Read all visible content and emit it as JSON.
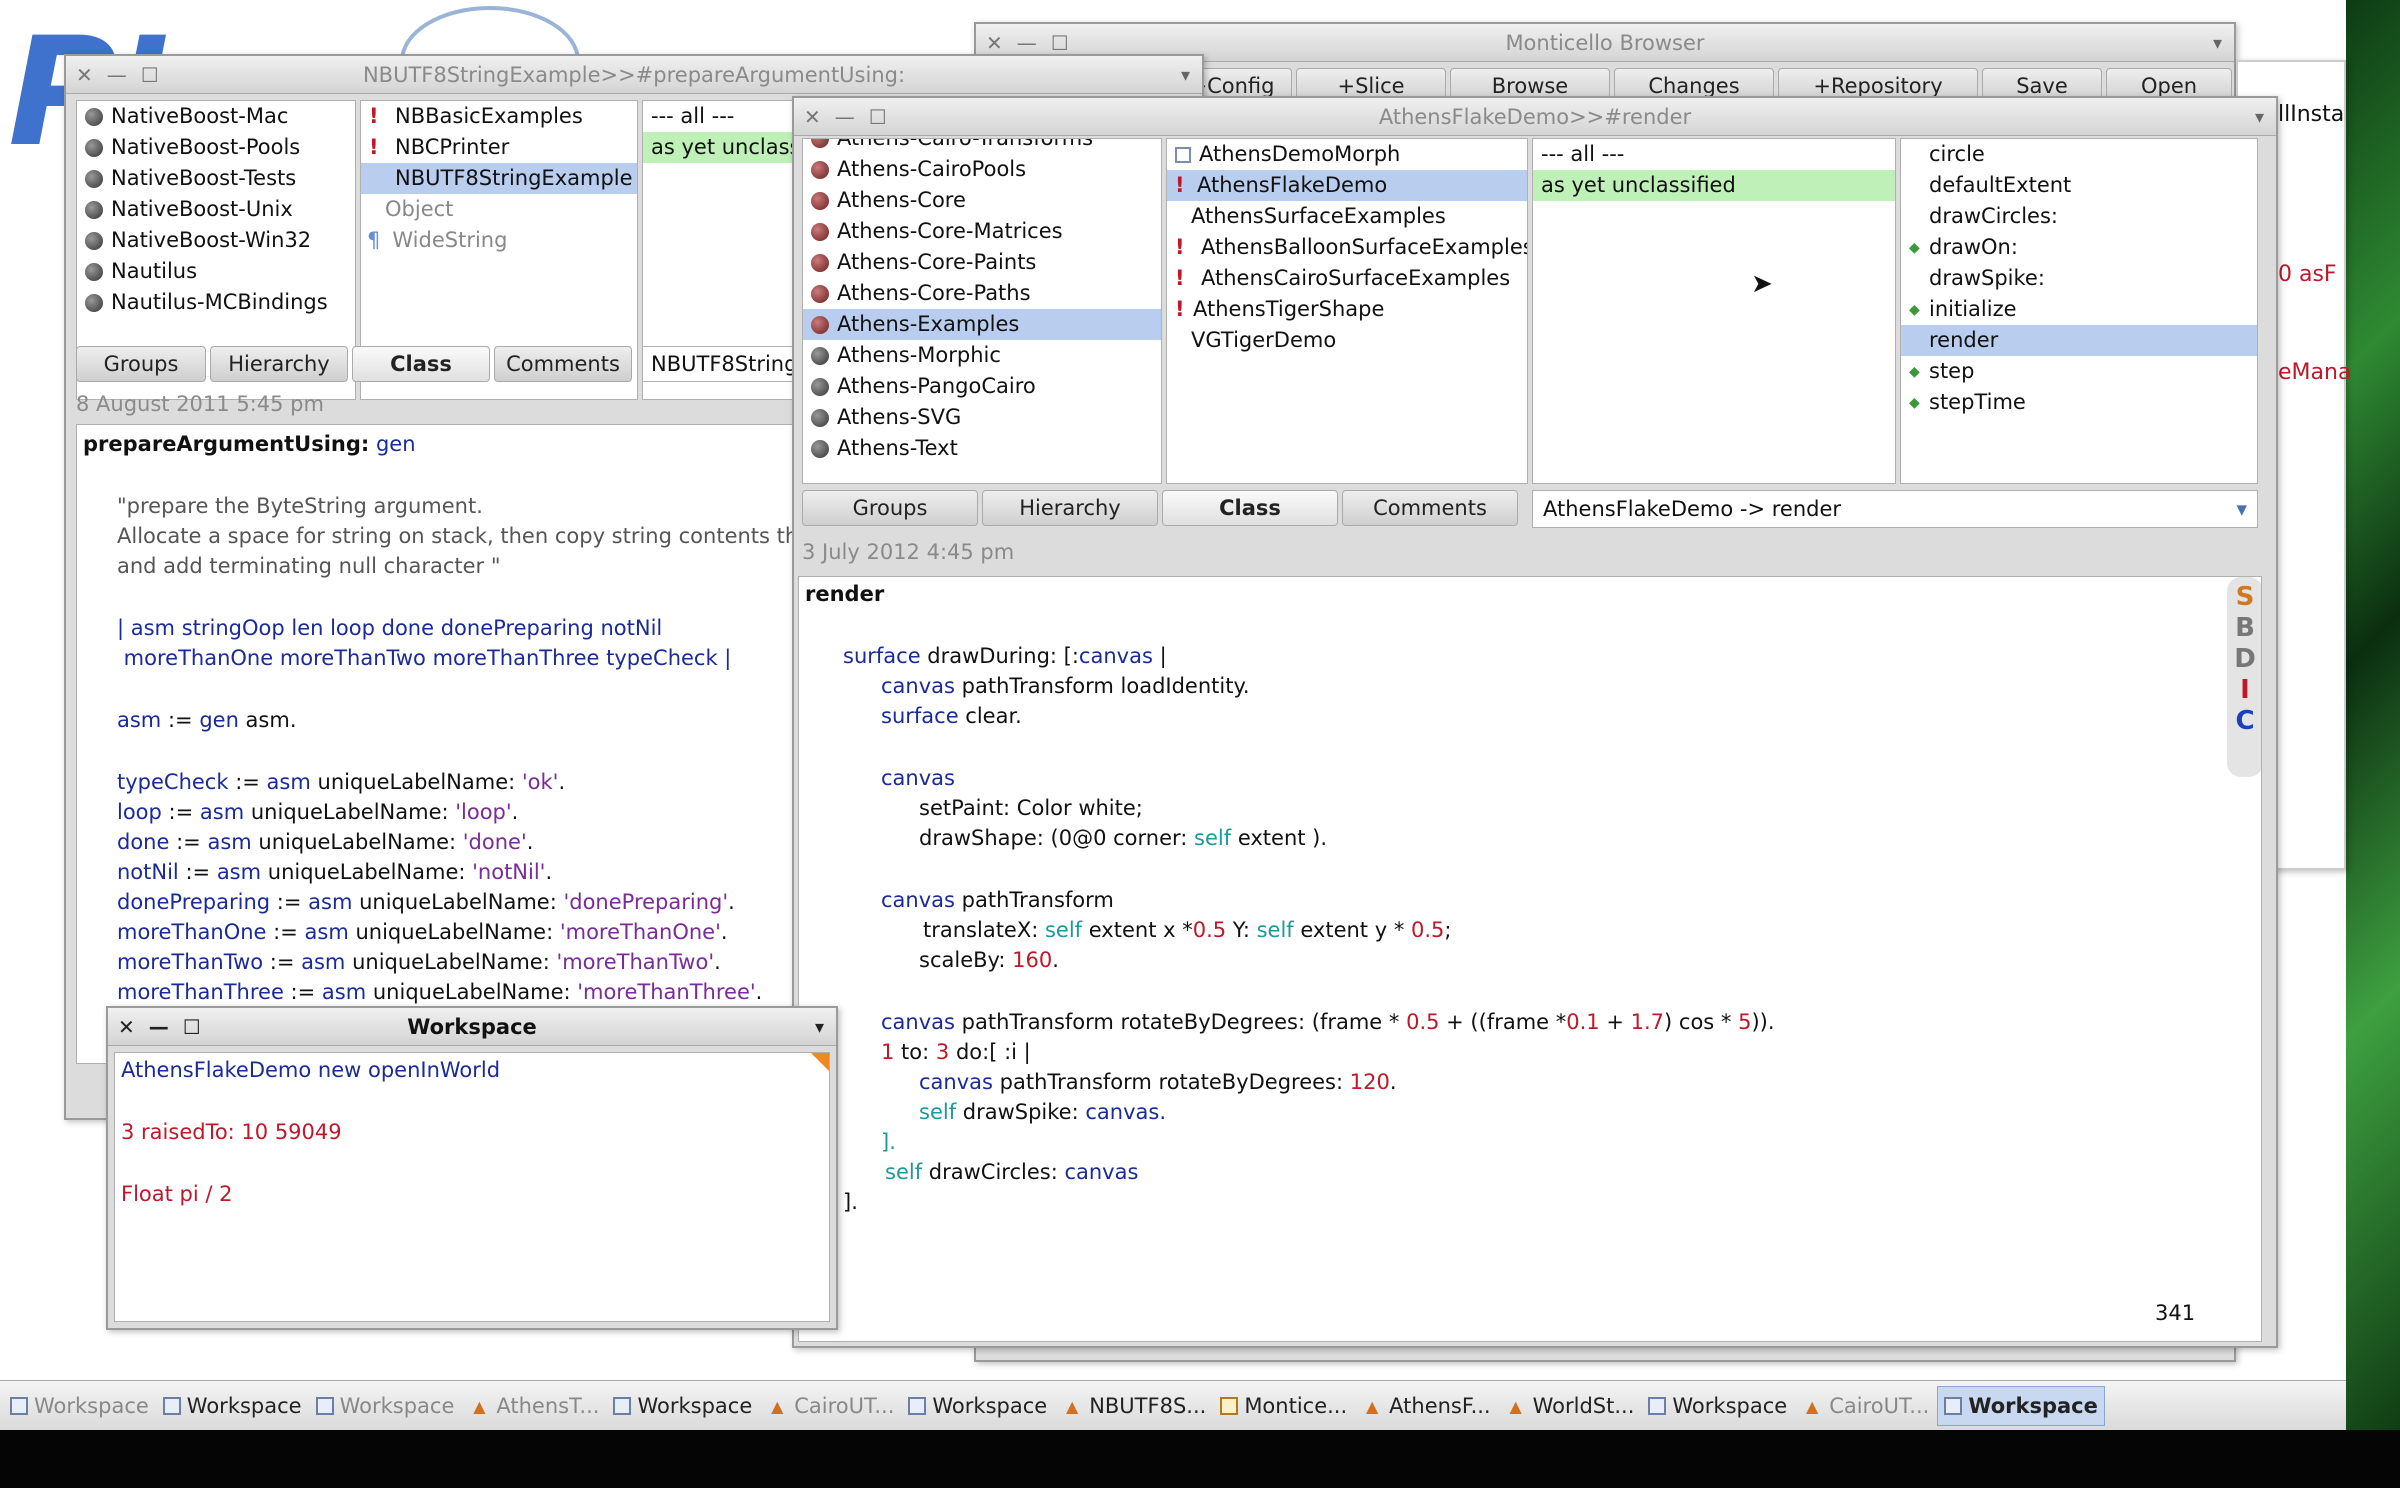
{
  "background": {
    "logo_text": "P!"
  },
  "monticello": {
    "title": "Monticello Browser",
    "buttons": [
      "+Config",
      "+Slice",
      "Browse",
      "Changes",
      "+Repository",
      "Save",
      "Open"
    ]
  },
  "right_partial": {
    "lines": [
      "llInsta",
      "0 asF",
      "eMana"
    ]
  },
  "nbutf8_browser": {
    "title": "NBUTF8StringExample>>#prepareArgumentUsing:",
    "packages": [
      "NativeBoost-Mac",
      "NativeBoost-Pools",
      "NativeBoost-Tests",
      "NativeBoost-Unix",
      "NativeBoost-Win32",
      "Nautilus",
      "Nautilus-MCBindings"
    ],
    "classes": [
      "NBBasicExamples",
      "NBCPrinter",
      "NBUTF8StringExample",
      "Object",
      "WideString"
    ],
    "protocols": [
      "--- all ---",
      "as yet unclassi"
    ],
    "tabs": {
      "groups": "Groups",
      "hierarchy": "Hierarchy",
      "class": "Class",
      "comments": "Comments"
    },
    "method_field": "NBUTF8String",
    "timestamp": "8 August 2011 5:45 pm",
    "selector": "prepareArgumentUsing:",
    "arg": "gen",
    "code": {
      "l1": "\"prepare the ByteString argument.",
      "l2": "Allocate a space for string on stack, then copy string contents there",
      "l3": "and add terminating null character \"",
      "l4": "| asm stringOop len loop done donePreparing notNil",
      "l5": " moreThanOne moreThanTwo moreThanThree typeCheck |",
      "l6a": "asm",
      "l6b": " := ",
      "l6c": "gen",
      "l6d": " asm.",
      "label_send": " uniqueLabelName: ",
      "asm": "asm",
      "assign": " := ",
      "vars": [
        "typeCheck",
        "loop",
        "done",
        "notNil",
        "donePreparing",
        "moreThanOne",
        "moreThanTwo",
        "moreThanThree"
      ],
      "labels": [
        "'ok'",
        "'loop'",
        "'done'",
        "'notNil'",
        "'donePreparing'",
        "'moreThanOne'",
        "'moreThanTwo'",
        "'moreThanThree'"
      ],
      "dot": "."
    }
  },
  "workspace": {
    "title": "Workspace",
    "lines": [
      "AthensFlakeDemo new openInWorld",
      "3 raisedTo: 10 59049",
      "Float pi / 2"
    ]
  },
  "athens_browser": {
    "title": "AthensFlakeDemo>>#render",
    "packages": [
      "Athens-Cairo-Transforms",
      "Athens-CairoPools",
      "Athens-Core",
      "Athens-Core-Matrices",
      "Athens-Core-Paints",
      "Athens-Core-Paths",
      "Athens-Examples",
      "Athens-Morphic",
      "Athens-PangoCairo",
      "Athens-SVG",
      "Athens-Text"
    ],
    "classes": [
      "AthensDemoMorph",
      "AthensFlakeDemo",
      "AthensSurfaceExamples",
      "AthensBalloonSurfaceExamples",
      "AthensCairoSurfaceExamples",
      "AthensTigerShape",
      "VGTigerDemo"
    ],
    "protocols": [
      "--- all ---",
      "as yet unclassified"
    ],
    "methods": [
      "circle",
      "defaultExtent",
      "drawCircles:",
      "drawOn:",
      "drawSpike:",
      "initialize",
      "render",
      "step",
      "stepTime"
    ],
    "tabs": {
      "groups": "Groups",
      "hierarchy": "Hierarchy",
      "class": "Class",
      "comments": "Comments"
    },
    "method_selector": "AthensFlakeDemo -> render",
    "timestamp": "3 July 2012 4:45 pm",
    "selector": "render",
    "side_tools": [
      "S",
      "B",
      "D",
      "I",
      "C"
    ],
    "char_count": "341",
    "code": {
      "surface": "surface",
      "canvas": "canvas",
      "self": "self",
      "drawDuring": " drawDuring: [:",
      "drawDuring_end": " |",
      "pathTransform": " pathTransform",
      "loadIdentity": " loadIdentity.",
      "clear": " clear.",
      "setPaint": "setPaint: Color white;",
      "drawShape": "drawShape: (",
      "p00": "0@0",
      "corner": " corner: ",
      "extent_paren": " extent ).",
      "translate_a": "translateX: ",
      "translate_b": " extent x *",
      "half": "0.5",
      "translate_c": " Y: ",
      "translate_d": " extent y * ",
      "semi": ";",
      "scaleBy": "scaleBy: ",
      "n160": "160",
      "dot": ".",
      "rot_a": " pathTransform rotateByDegrees: (frame * ",
      "rot_b": " + ((frame *",
      "n01": "0.1",
      "plus": " + ",
      "n17": "1.7",
      "cos": ") cos * ",
      "n5": "5",
      "close": ")).",
      "to_a": "1",
      "to_b": " to: ",
      "to_c": "3",
      "to_d": " do:[ :i |",
      "rot120": " pathTransform rotateByDegrees: ",
      "n120": "120",
      "drawSpike": " drawSpike: ",
      "canvas_dot": "canvas.",
      "close_block": "].",
      "drawCircles": " drawCircles: ",
      "canvas_plain": "canvas",
      "final": "]."
    }
  },
  "taskbar": {
    "items": [
      "Workspace",
      "Workspace",
      "Workspace",
      "AthensT...",
      "Workspace",
      "CairoUT...",
      "Workspace",
      "NBUTF8S...",
      "Montice...",
      "AthensF...",
      "WorldSt...",
      "Workspace",
      "CairoUT...",
      "Workspace"
    ]
  },
  "colors": {
    "selection": "#b9cdef",
    "protocol_green": "#bff0b7",
    "keyword_blue": "#1a2a9a",
    "string_purple": "#7a2a9a",
    "number_red": "#c0182a",
    "self_teal": "#1a9a9a"
  }
}
